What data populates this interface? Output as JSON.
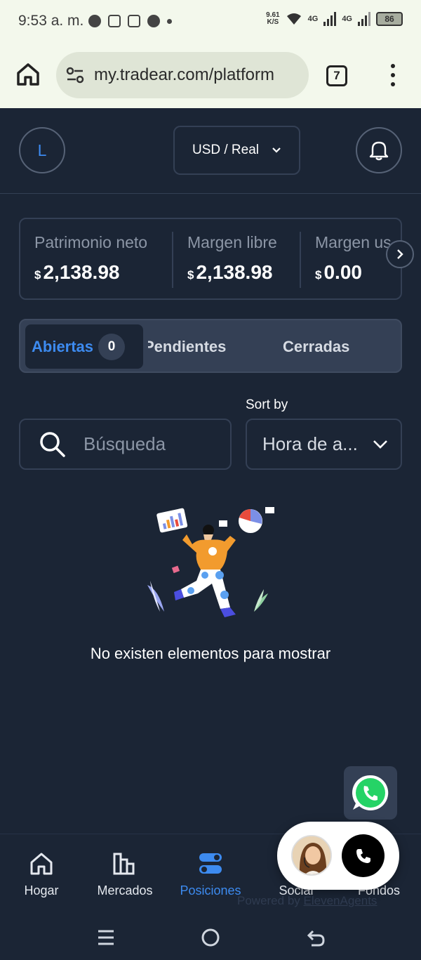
{
  "status_bar": {
    "time": "9:53 a. m.",
    "net_speed_value": "9.61",
    "net_speed_unit": "K/S",
    "signal_1": "4G",
    "signal_2": "4G",
    "battery": "86"
  },
  "browser": {
    "url": "my.tradear.com/platform",
    "tab_count": "7"
  },
  "header": {
    "avatar_initial": "L",
    "account_label": "USD / Real"
  },
  "stats": [
    {
      "label": "Patrimonio neto",
      "currency": "$",
      "value": "2,138.98"
    },
    {
      "label": "Margen libre",
      "currency": "$",
      "value": "2,138.98"
    },
    {
      "label": "Margen us",
      "currency": "$",
      "value": "0.00"
    }
  ],
  "tabs": {
    "open_label": "Abiertas",
    "open_count": "0",
    "pending_label": "Pendientes",
    "closed_label": "Cerradas"
  },
  "filters": {
    "sort_label": "Sort by",
    "search_placeholder": "Búsqueda",
    "sort_value": "Hora de a..."
  },
  "empty_state": {
    "message": "No existen elementos para mostrar"
  },
  "bottom_nav": [
    {
      "label": "Hogar",
      "icon": "home-icon"
    },
    {
      "label": "Mercados",
      "icon": "bar-chart-icon"
    },
    {
      "label": "Posiciones",
      "icon": "toggle-icon"
    },
    {
      "label": "Social",
      "icon": "social-icon"
    },
    {
      "label": "Fondos",
      "icon": "wallet-icon"
    }
  ],
  "powered_by": {
    "prefix": "Powered by",
    "brand": "ElevenAgents"
  },
  "colors": {
    "background": "#1b2535",
    "border": "#344055",
    "accent": "#3d8bf0",
    "muted_text": "#8c96a6",
    "whatsapp": "#25d366"
  }
}
